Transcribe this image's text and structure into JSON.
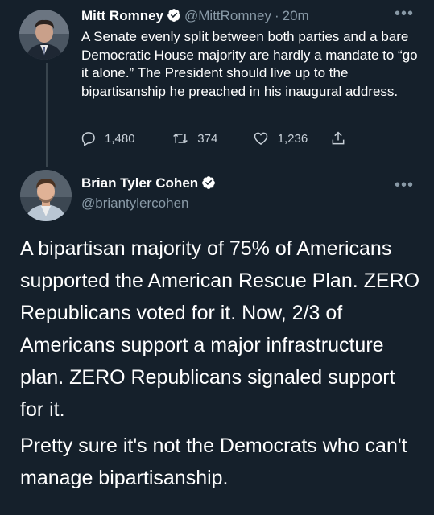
{
  "tweet1": {
    "name": "Mitt Romney",
    "handle": "@MittRomney",
    "separator": "·",
    "time": "20m",
    "text": "A Senate evenly split between both parties and a bare Democratic House majority are hardly a mandate to “go it alone.” The President should live up to the bipartisanship he preached in his inaugural address.",
    "reply_count": "1,480",
    "retweet_count": "374",
    "like_count": "1,236"
  },
  "tweet2": {
    "name": "Brian Tyler Cohen",
    "handle": "@briantylercohen",
    "paragraph1": "A bipartisan majority of 75% of Americans supported the American Rescue Plan. ZERO Republicans voted for it. Now, 2/3 of Americans support a major infrastructure plan. ZERO Republicans signaled support for it.",
    "paragraph2": "Pretty sure it's not the Democrats who can't manage bipartisanship."
  },
  "icons": {
    "verified": "verified-badge-icon",
    "reply": "reply-icon",
    "retweet": "retweet-icon",
    "like": "heart-icon",
    "share": "share-icon",
    "more": "more-options-icon"
  },
  "colors": {
    "background": "#15202b",
    "text": "#ffffff",
    "secondary": "#8899a6",
    "verified": "#1da1f2"
  },
  "more_label": "•••"
}
